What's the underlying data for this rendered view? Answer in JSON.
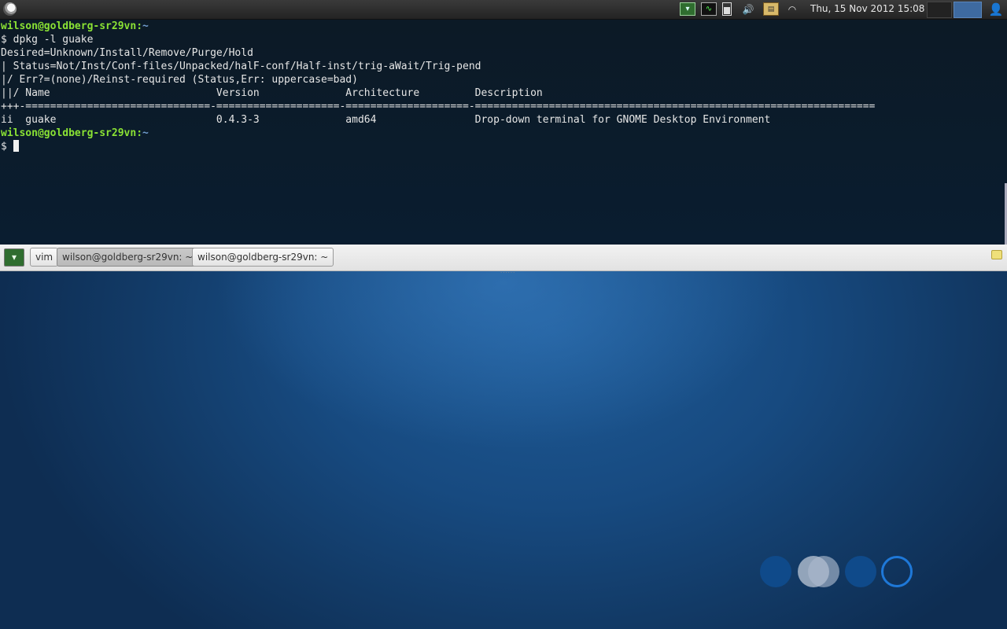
{
  "top_panel": {
    "clock": "Thu, 15 Nov 2012 15:08",
    "tray_icons": [
      "guake-icon",
      "system-monitor-icon",
      "battery-icon",
      "volume-icon",
      "clipboard-icon",
      "wifi-icon"
    ],
    "volume_glyph": "🔊",
    "wifi_glyph": "◠",
    "guake_glyph": "▾",
    "sysmon_glyph": "∿",
    "clipboard_glyph": "▤",
    "user_glyph": "👤"
  },
  "terminal": {
    "user_host": "wilson@goldberg-sr29vn",
    "cwd": "~",
    "command": "$ dpkg -l guake",
    "output": [
      "Desired=Unknown/Install/Remove/Purge/Hold",
      "| Status=Not/Inst/Conf-files/Unpacked/halF-conf/Half-inst/trig-aWait/Trig-pend",
      "|/ Err?=(none)/Reinst-required (Status,Err: uppercase=bad)",
      "||/ Name                           Version              Architecture         Description",
      "+++-==============================-====================-====================-=================================================================",
      "ii  guake                          0.4.3-3              amd64                Drop-down terminal for GNOME Desktop Environment"
    ],
    "prompt_symbol": "$ "
  },
  "tab_bar": {
    "add_button_glyph": "▾",
    "tabs": [
      {
        "label": "vim"
      },
      {
        "label": "wilson@goldberg-sr29vn: ~"
      },
      {
        "label": "wilson@goldberg-sr29vn: ~"
      }
    ],
    "active_tab_index": 1,
    "resize_glyph": "......"
  },
  "colors": {
    "prompt_green": "#8ae234",
    "prompt_blue": "#729fcf",
    "terminal_bg": "#0b1b2b",
    "wallpaper_blue": "#174a80"
  }
}
